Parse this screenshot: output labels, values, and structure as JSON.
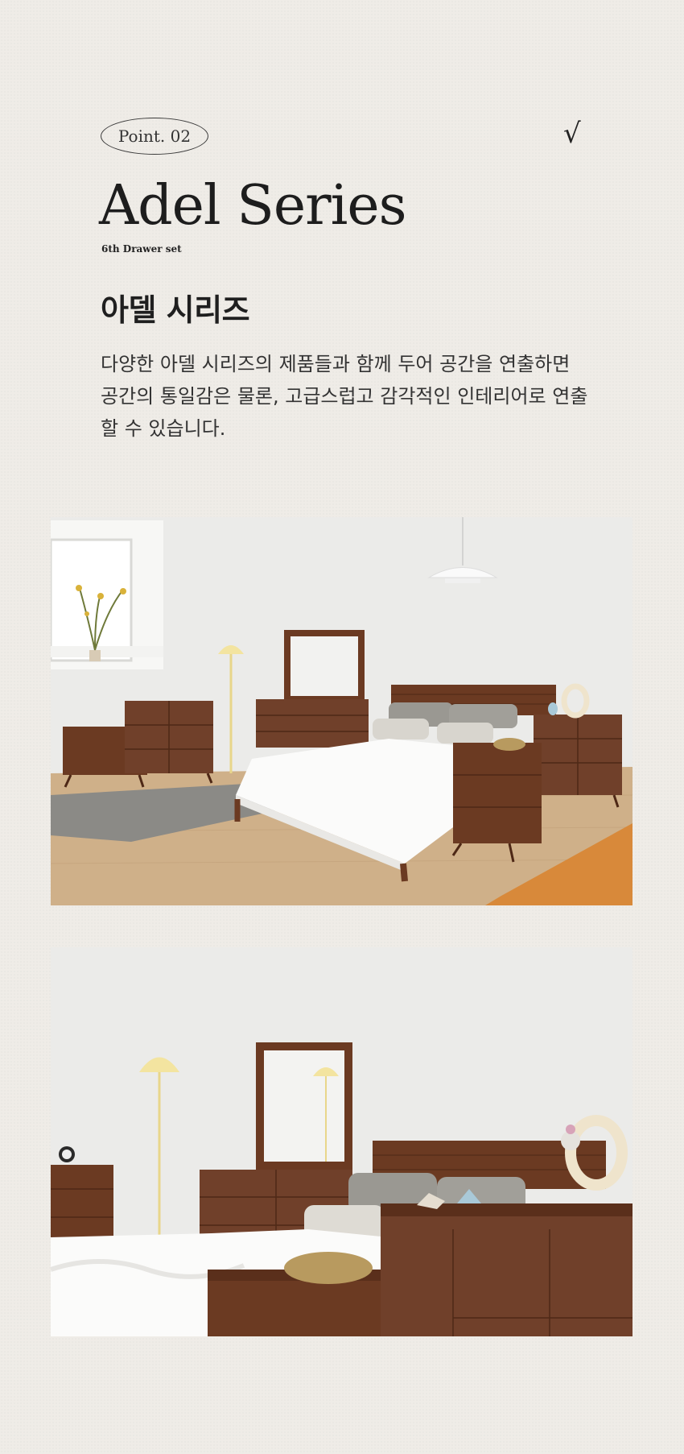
{
  "badge": "Point. 02",
  "check_mark": "√",
  "title": "Adel Series",
  "subtitle": "6th Drawer set",
  "heading": "아델 시리즈",
  "description": {
    "line1": "다양한 아델 시리즈의 제품들과 함께 두어 공간을 연출하면",
    "line2": "공간의 통일감은 물론, 고급스럽고 감각적인 인테리어로 연출",
    "line3": "할 수 있습니다."
  },
  "colors": {
    "background": "#efece7",
    "wood": "#6b3a22",
    "wood_dark": "#4e2816",
    "wall": "#ececea",
    "floor": "#cdb08a",
    "rug_orange": "#d8893a",
    "lamp_yellow": "#f3e4a0"
  }
}
